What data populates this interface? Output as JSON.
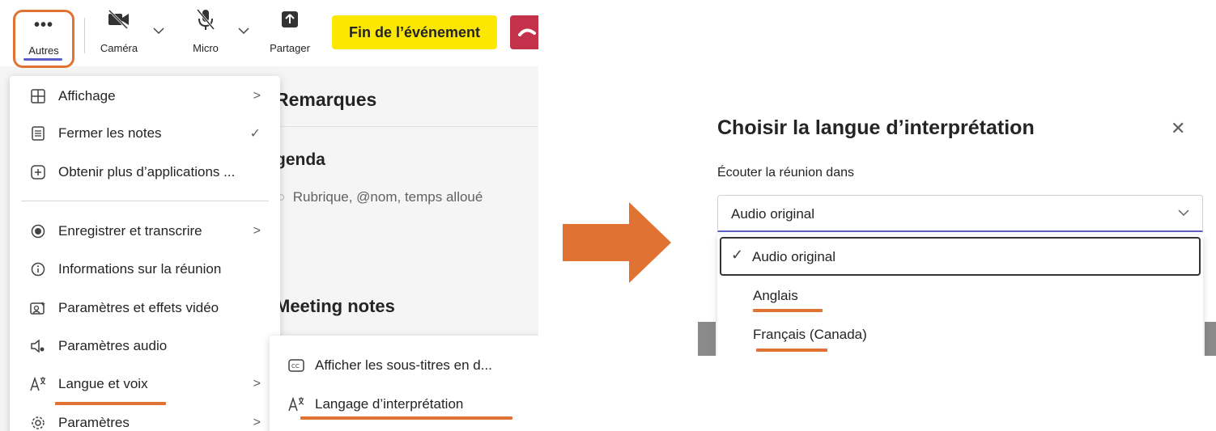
{
  "toolbar": {
    "more_label": "Autres",
    "camera_label": "Caméra",
    "mic_label": "Micro",
    "share_label": "Partager",
    "end_event_label": "Fin de l’événement"
  },
  "notes_panel": {
    "heading_remarks": "Remarques",
    "heading_agenda": "genda",
    "agenda_placeholder": "Rubrique, @nom, temps alloué",
    "heading_meeting_notes": "Meeting notes"
  },
  "menu": {
    "items": [
      {
        "label": "Affichage",
        "icon": "grid-icon",
        "right": ">"
      },
      {
        "label": "Fermer les notes",
        "icon": "notes-icon",
        "right": "✓"
      },
      {
        "label": "Obtenir plus d’applications ...",
        "icon": "add-app-icon",
        "right": ""
      },
      {
        "label": "Enregistrer et transcrire",
        "icon": "record-icon",
        "right": ">"
      },
      {
        "label": "Informations sur la réunion",
        "icon": "info-icon",
        "right": ""
      },
      {
        "label": "Paramètres et effets vidéo",
        "icon": "video-effects-icon",
        "right": ""
      },
      {
        "label": "Paramètres audio",
        "icon": "audio-settings-icon",
        "right": ""
      },
      {
        "label": "Langue et voix",
        "icon": "language-icon",
        "right": ">"
      },
      {
        "label": "Paramètres",
        "icon": "gear-icon",
        "right": ">"
      }
    ]
  },
  "submenu": {
    "items": [
      {
        "label": "Afficher les sous-titres en d...",
        "icon": "captions-icon"
      },
      {
        "label": "Langage d’interprétation",
        "icon": "language-icon"
      }
    ]
  },
  "dialog": {
    "title": "Choisir la langue d’interprétation",
    "close_glyph": "✕",
    "field_label": "Écouter la réunion dans",
    "selected_value": "Audio original",
    "options": [
      "Audio original",
      "Anglais",
      "Français (Canada)"
    ]
  },
  "colors": {
    "highlight_orange": "#e07333",
    "end_button_yellow": "#fbe700",
    "accent_purple": "#5b5fc7",
    "hangup_red": "#c4314b"
  }
}
